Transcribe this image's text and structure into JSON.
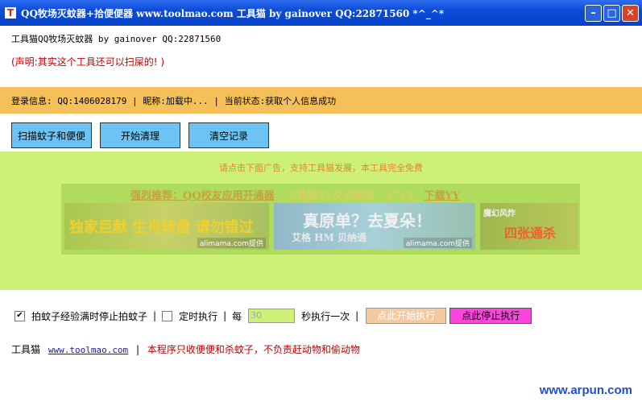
{
  "window": {
    "title": "QQ牧场灭蚊器+拾便便器 www.toolmao.com 工具猫 by gainover QQ:22871560 *^_^*",
    "icon": "T"
  },
  "header": {
    "info": "工具猫QQ牧场灭蚊器 by gainover QQ:22871560",
    "notice": "(声明:其实这个工具还可以扫屎的! )"
  },
  "login_bar": {
    "text": "登录信息: QQ:1406028179 | 昵称:加载中... | 当前状态:获取个人信息成功"
  },
  "buttons": {
    "scan": "扫描蚊子和便便",
    "start": "开始清理",
    "clear": "清空记录"
  },
  "ad": {
    "note": "请点击下面广告，支持工具猫发展，本工具完全免费",
    "recommend": "强烈推荐：QQ校友应用开通器",
    "channel": "工具猫YY交流频道：2712",
    "download": "下载YY",
    "banner1_text": "独家巨献 生肖转盘 请勿错过",
    "banner1_provider": "alimama.com提供",
    "banner2_text": "真原单？去夏朵！",
    "banner2_sub": "艾格 HM 贝纳通",
    "banner2_provider": "alimama.com提供",
    "banner3_top": "魔幻风炸",
    "banner3_text": "四张通杀"
  },
  "options": {
    "stop_when_full_label": "拍蚊子经验满时停止拍蚊子",
    "stop_when_full_checked": true,
    "timed_label": "定时执行",
    "timed_checked": false,
    "every_label": "每",
    "interval_value": "30",
    "interval_suffix": "秒执行一次",
    "start_exec": "点此开始执行",
    "stop_exec": "点此停止执行",
    "separator": "|"
  },
  "footer": {
    "brand": "工具猫",
    "link": "www.toolmao.com",
    "separator": "|",
    "disclaimer": "本程序只收便便和杀蚊子，不负责赶动物和偷动物"
  },
  "watermark": "www.arpun.com"
}
